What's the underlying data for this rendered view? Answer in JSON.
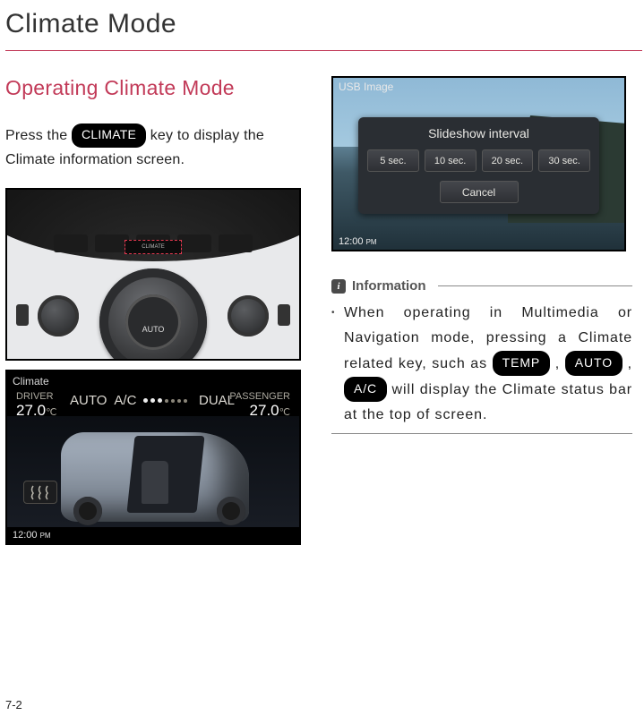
{
  "page": {
    "title": "Climate Mode",
    "number": "7-2"
  },
  "section": {
    "heading": "Operating Climate Mode",
    "intro_a": "Press the ",
    "intro_key": "CLIMATE",
    "intro_b": " key to display the Climate information screen."
  },
  "fig1": {
    "climate_btn": "CLIMATE",
    "auto_label": "AUTO"
  },
  "fig2": {
    "header": "Climate",
    "driver_label": "DRIVER",
    "driver_temp": "27.0",
    "driver_unit": "℃",
    "passenger_label": "PASSENGER",
    "passenger_temp": "27.0",
    "passenger_unit": "℃",
    "auto": "AUTO",
    "ac": "A/C",
    "dual": "DUAL",
    "clock": "12:00",
    "ampm": "PM"
  },
  "fig3": {
    "header": "USB Image",
    "popup_title": "Slideshow interval",
    "options": [
      "5 sec.",
      "10 sec.",
      "20 sec.",
      "30 sec."
    ],
    "cancel": "Cancel",
    "clock": "12:00",
    "ampm": "PM"
  },
  "info": {
    "label": "Information",
    "badge": "i",
    "bullet": "•",
    "t1": "When operating in Multimedia or Navigation mode, pressing a Climate related key, such as ",
    "k1": "TEMP",
    "sep1": " , ",
    "k2": "AUTO",
    "sep2": " , ",
    "k3": "A/C",
    "t2": " will display the Climate status bar at the top of screen."
  }
}
